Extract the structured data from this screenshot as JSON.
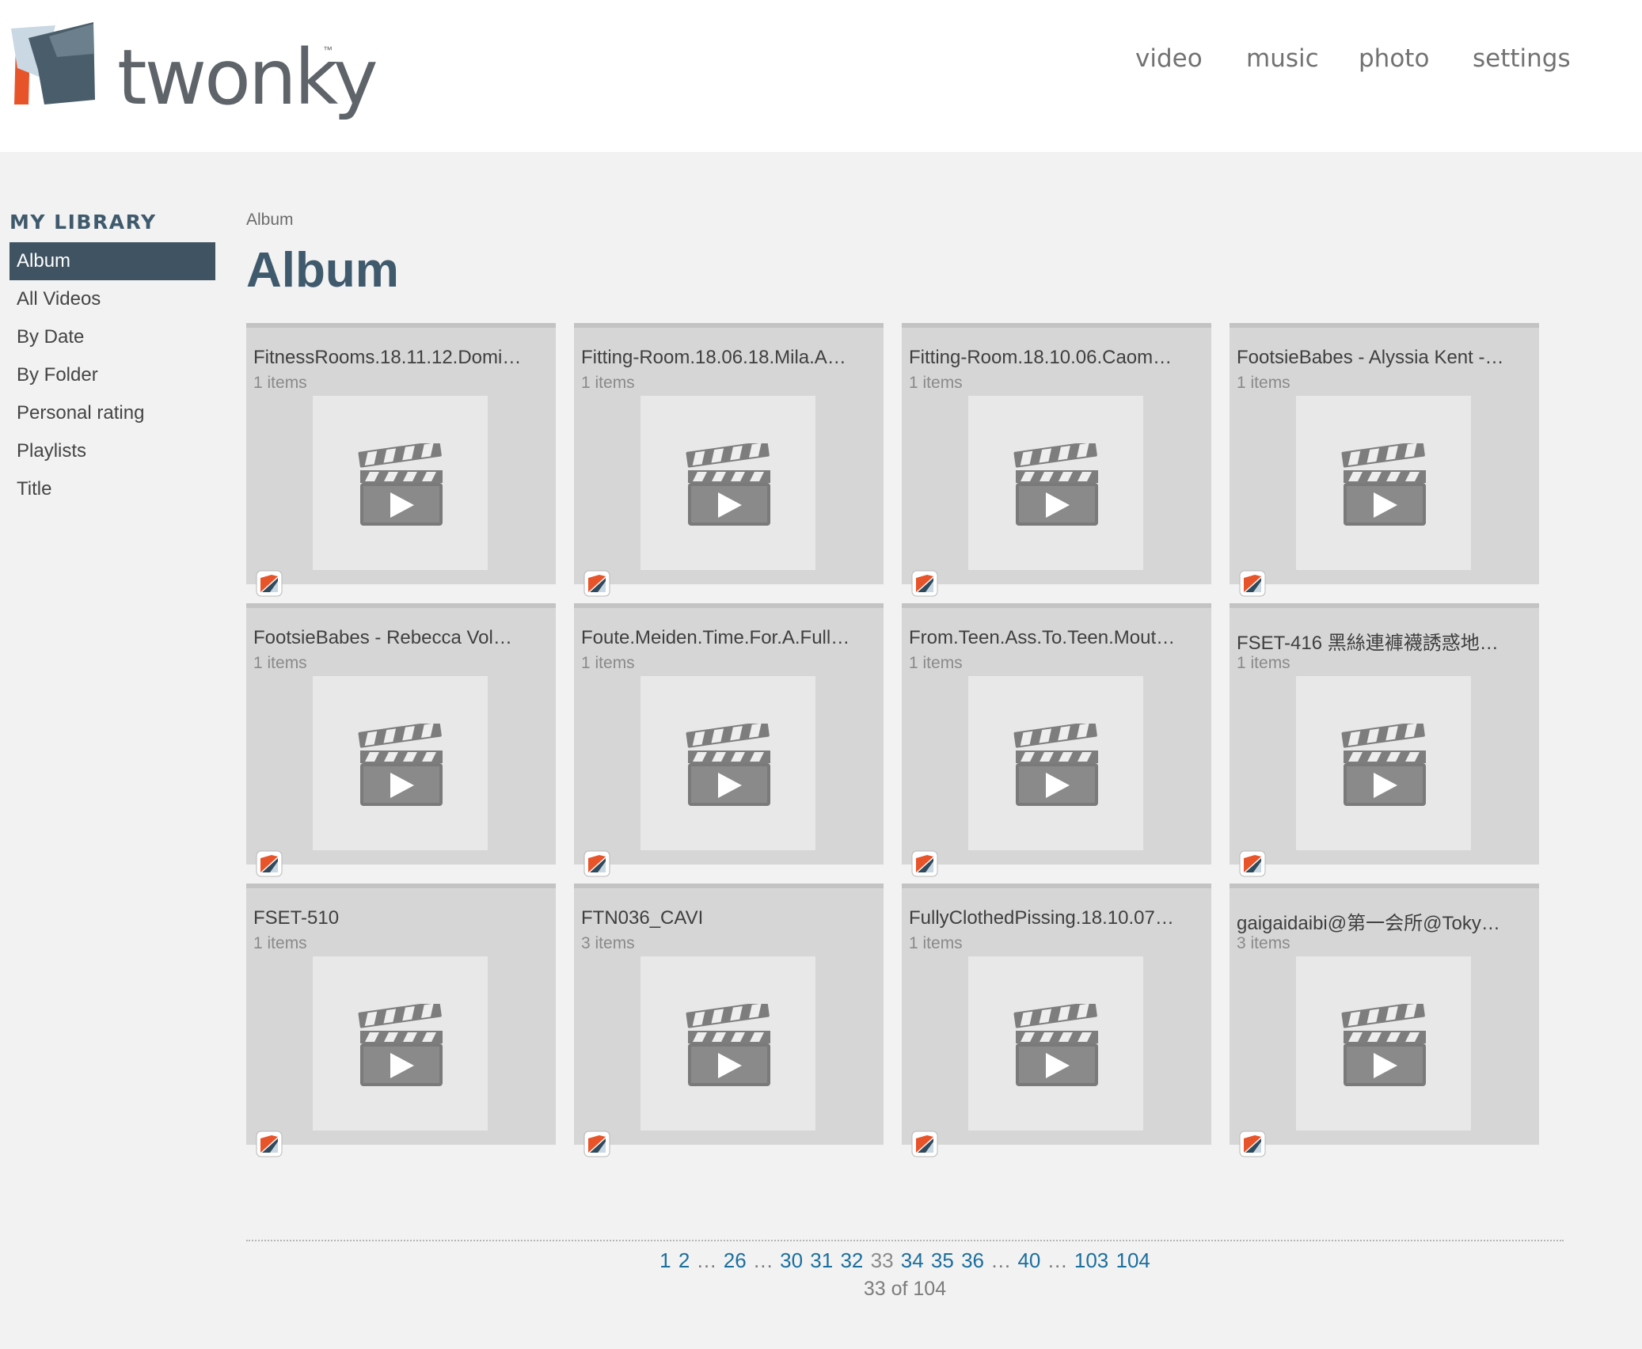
{
  "brand": {
    "name": "twonky",
    "tm": "™"
  },
  "nav": {
    "video": "video",
    "music": "music",
    "photo": "photo",
    "settings": "settings"
  },
  "sidebar": {
    "title": "MY LIBRARY",
    "items": [
      {
        "label": "Album",
        "active": true
      },
      {
        "label": "All Videos"
      },
      {
        "label": "By Date"
      },
      {
        "label": "By Folder"
      },
      {
        "label": "Personal rating"
      },
      {
        "label": "Playlists"
      },
      {
        "label": "Title"
      }
    ]
  },
  "breadcrumb": "Album",
  "page_title": "Album",
  "tiles": [
    {
      "title": "FitnessRooms.18.11.12.Domi…",
      "count": "1 items"
    },
    {
      "title": "Fitting-Room.18.06.18.Mila.A…",
      "count": "1 items"
    },
    {
      "title": "Fitting-Room.18.10.06.Caom…",
      "count": "1 items"
    },
    {
      "title": "FootsieBabes - Alyssia Kent -…",
      "count": "1 items"
    },
    {
      "title": "FootsieBabes - Rebecca Vol…",
      "count": "1 items"
    },
    {
      "title": "Foute.Meiden.Time.For.A.Full…",
      "count": "1 items"
    },
    {
      "title": "From.Teen.Ass.To.Teen.Mout…",
      "count": "1 items"
    },
    {
      "title": "FSET-416 黑絲連褲襪誘惑地…",
      "count": "1 items"
    },
    {
      "title": "FSET-510",
      "count": "1 items"
    },
    {
      "title": "FTN036_CAVI",
      "count": "3 items"
    },
    {
      "title": "FullyClothedPissing.18.10.07…",
      "count": "1 items"
    },
    {
      "title": "gaigaidaibi@第一会所@Toky…",
      "count": "3 items"
    }
  ],
  "pagination": {
    "pages": [
      "1",
      "2",
      "…",
      "26",
      "…",
      "30",
      "31",
      "32",
      "33",
      "34",
      "35",
      "36",
      "…",
      "40",
      "…",
      "103",
      "104"
    ],
    "current": "33",
    "status": "33 of 104"
  },
  "colors": {
    "accent": "#3f5a6d",
    "sidebar_active": "#3f5362",
    "link": "#1b6f9e",
    "logo_orange": "#e8542a"
  }
}
